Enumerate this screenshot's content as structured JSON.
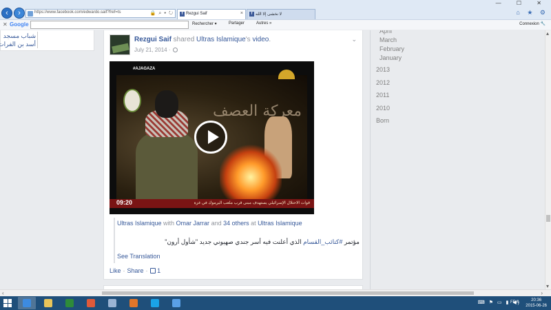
{
  "browser": {
    "address_url": "https://www.facebook.com/edwardo.saif?fref=ts",
    "addr_icons": "🔒 ⌕ ▾ ↻",
    "tabs": [
      {
        "label": "Rezgui Saif",
        "icon": "facebook-icon"
      },
      {
        "label": "لا نخشى إلا الله",
        "icon": "facebook-icon"
      }
    ],
    "window_controls": "— ☐ ✕",
    "cmd_icons": "⌂ ★ ⚙",
    "google_bar": {
      "logo": "Google",
      "items": [
        "Rechercher ▾",
        "Partager",
        "Autres »"
      ],
      "connexion": "Connexion 🔧"
    }
  },
  "left_links": [
    "شباب مسجد",
    "أسد بن الفرات"
  ],
  "post": {
    "author": "Rezgui Saif",
    "action_text": " shared ",
    "source_page": "Ultras Islamique",
    "source_suffix": "'s ",
    "object_link": "video",
    "period": ".",
    "date": "July 21, 2014 ·",
    "video": {
      "channel": "#AJAGAZA",
      "duration": "09:20",
      "overlay_title": "معركة العصف",
      "ticker": "قوات الاحتلال الإسرائيلي يستهدف مبنى قرب ملعب اليرموك في غزة"
    },
    "tag": {
      "page": "Ultras Islamique",
      "with": " with ",
      "person": "Omar Jarrar",
      "and": " and ",
      "others": "34 others",
      "at": " at ",
      "place": "Ultras Islamique"
    },
    "text_prefix": "مؤتمر ",
    "hashtag": "#كتائب_القسام",
    "text_suffix": " الذي أعلنت فيه أسر جندي صهيوني جديد \"شأول أرون\"",
    "see_translation": "See Translation",
    "actions": {
      "like": "Like",
      "share": "Share",
      "like_count": "1"
    }
  },
  "timeline": {
    "months": [
      "April",
      "March",
      "February",
      "January"
    ],
    "years": [
      "2013",
      "2012",
      "2011",
      "2010",
      "Born"
    ]
  },
  "taskbar": {
    "apps": [
      {
        "name": "ie-icon",
        "color": "#3d8be0",
        "active": true
      },
      {
        "name": "explorer-icon",
        "color": "#e8c45a",
        "active": false
      },
      {
        "name": "excel-icon",
        "color": "#2e8b3a",
        "active": false
      },
      {
        "name": "chrome-icon",
        "color": "#e05a3a",
        "active": false
      },
      {
        "name": "app-icon",
        "color": "#9ab4d4",
        "active": false
      },
      {
        "name": "firefox-icon",
        "color": "#e2762a",
        "active": false
      },
      {
        "name": "skype-icon",
        "color": "#1aa3e8",
        "active": false
      },
      {
        "name": "messenger-icon",
        "color": "#5aa0e6",
        "active": false
      }
    ],
    "tray": "⌨ ⚑ ▭ ▮ ◀)",
    "lang": "FRA",
    "time": "20:36",
    "date": "2015-06-26"
  },
  "colors": {
    "link": "#365899",
    "taskbar": "#1f4f7a",
    "muted": "#90949c"
  }
}
